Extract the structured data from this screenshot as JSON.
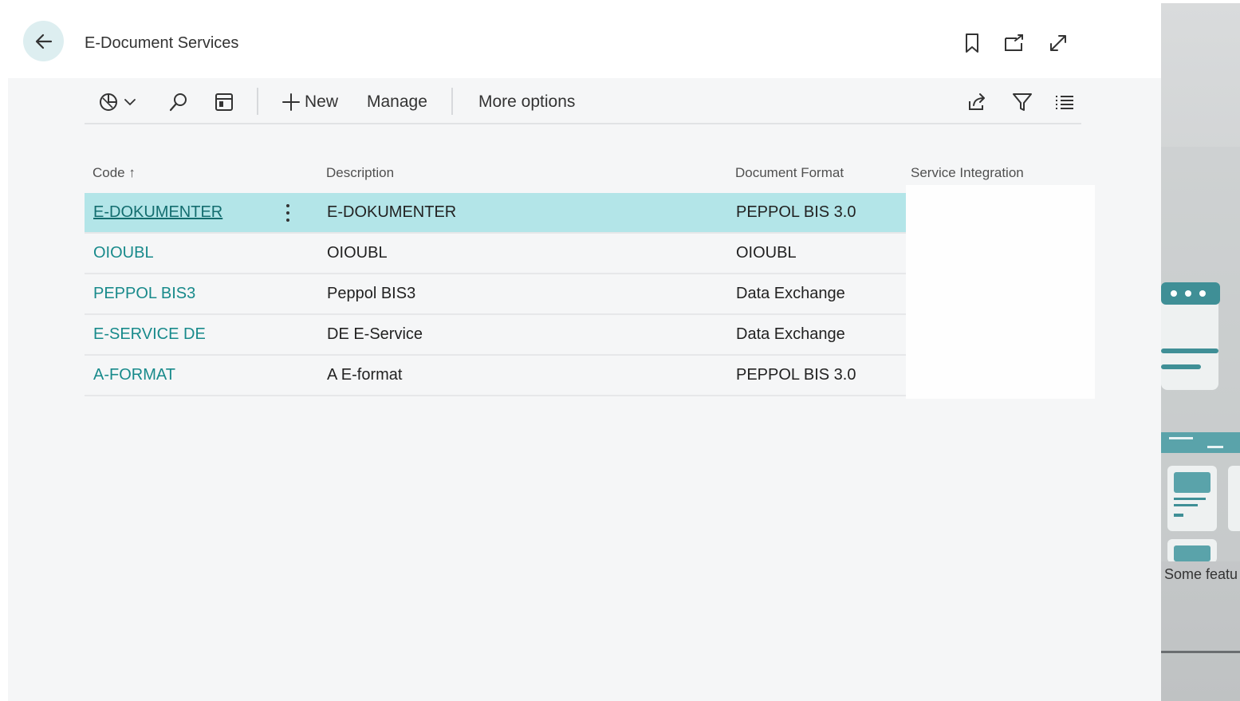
{
  "page": {
    "title": "E-Document Services"
  },
  "header_icons": [
    "bookmark-icon",
    "open-in-new-window-icon",
    "expand-icon"
  ],
  "actionbar": {
    "new_label": "New",
    "manage_label": "Manage",
    "more_options_label": "More options"
  },
  "table": {
    "columns": {
      "code": "Code",
      "code_sort": "↑",
      "description": "Description",
      "format": "Document Format",
      "integration": "Service Integration"
    },
    "rows": [
      {
        "code": "E-DOKUMENTER",
        "description": "E-DOKUMENTER",
        "format": "PEPPOL BIS 3.0",
        "selected": true
      },
      {
        "code": "OIOUBL",
        "description": "OIOUBL",
        "format": "OIOUBL",
        "selected": false
      },
      {
        "code": "PEPPOL BIS3",
        "description": "Peppol BIS3",
        "format": "Data Exchange",
        "selected": false
      },
      {
        "code": "E-SERVICE DE",
        "description": "DE E-Service",
        "format": "Data Exchange",
        "selected": false
      },
      {
        "code": "A-FORMAT",
        "description": "A E-format",
        "format": "PEPPOL BIS 3.0",
        "selected": false
      }
    ]
  },
  "side_panel": {
    "note": "Some featu"
  },
  "colors": {
    "accent": "#188a8b",
    "selected_row": "#b3e5e8",
    "back_button_bg": "#ddeef0",
    "page_bg": "#f5f6f7"
  }
}
